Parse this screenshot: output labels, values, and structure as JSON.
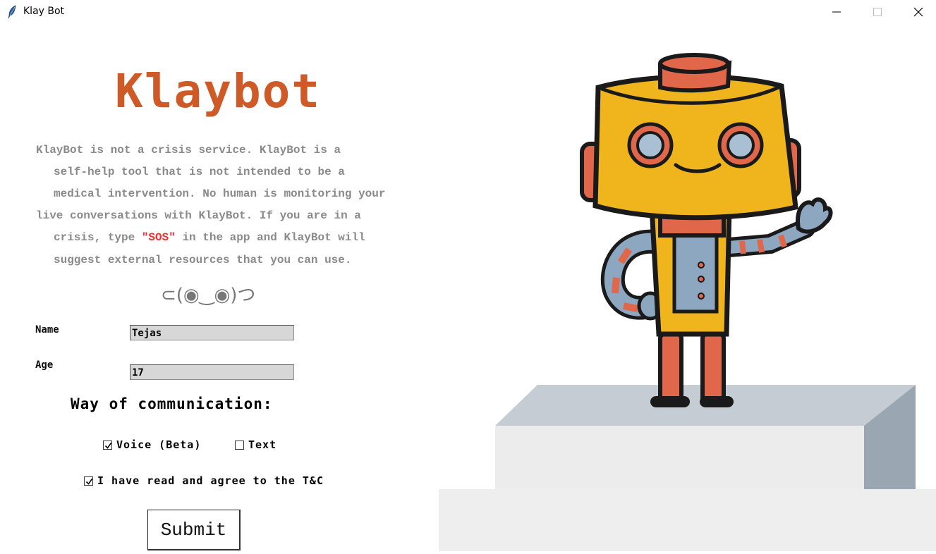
{
  "window": {
    "title": "Klay Bot"
  },
  "logo": "Klaybot",
  "disclaimer": {
    "line1": "KlayBot is not a crisis service. KlayBot is a",
    "line2": "self-help tool that is not intended to be a",
    "line3": "medical intervention. No human is monitoring your",
    "line4": "live conversations with KlayBot. If you are in a",
    "line5_before": "crisis, type ",
    "line5_sos": "\"SOS\"",
    "line5_after": " in the app and KlayBot will",
    "line6": "suggest external resources that you can use."
  },
  "kaomoji": "⊂(◉‿◉)つ",
  "form": {
    "name_label": "Name",
    "name_value": "Tejas",
    "age_label": "Age",
    "age_value": "17",
    "communication_title": "Way of communication:",
    "voice_label": "Voice (Beta)",
    "voice_checked": true,
    "text_label": "Text",
    "text_checked": false,
    "terms_label": "I have read and agree to the T&C",
    "terms_checked": true,
    "submit_label": "Submit"
  },
  "icons": {
    "app": "feather-icon",
    "minimize": "minimize-icon",
    "maximize": "maximize-icon",
    "close": "close-icon",
    "checkmark": "checkmark-icon"
  },
  "colors": {
    "logo": "#cd5a27",
    "sos": "#ff2a2a",
    "disclaimer_text": "#8a8a8a",
    "robot_body": "#f0b51c",
    "robot_accent": "#e0674a"
  }
}
